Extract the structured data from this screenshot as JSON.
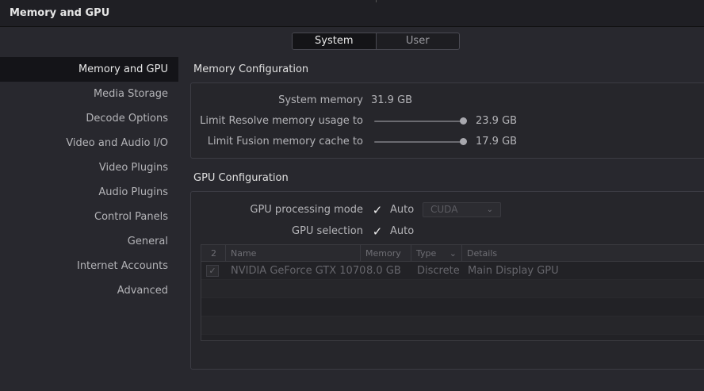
{
  "window": {
    "title": "Memory and GPU"
  },
  "tabs": {
    "system": "System",
    "user": "User"
  },
  "sidebar": {
    "items": [
      {
        "label": "Memory and GPU"
      },
      {
        "label": "Media Storage"
      },
      {
        "label": "Decode Options"
      },
      {
        "label": "Video and Audio I/O"
      },
      {
        "label": "Video Plugins"
      },
      {
        "label": "Audio Plugins"
      },
      {
        "label": "Control Panels"
      },
      {
        "label": "General"
      },
      {
        "label": "Internet Accounts"
      },
      {
        "label": "Advanced"
      }
    ]
  },
  "memory": {
    "title": "Memory Configuration",
    "system_memory_label": "System memory",
    "system_memory_value": "31.9 GB",
    "resolve_limit_label": "Limit Resolve memory usage to",
    "resolve_limit_value": "23.9 GB",
    "resolve_limit_fraction": 1.0,
    "fusion_cache_label": "Limit Fusion memory cache to",
    "fusion_cache_value": "17.9 GB",
    "fusion_cache_fraction": 1.0
  },
  "gpu": {
    "title": "GPU Configuration",
    "processing_mode_label": "GPU processing mode",
    "processing_mode_auto": "Auto",
    "processing_mode_select": "CUDA",
    "selection_label": "GPU selection",
    "selection_auto": "Auto",
    "table": {
      "headers": {
        "count": "2",
        "name": "Name",
        "memory": "Memory",
        "type": "Type",
        "details": "Details"
      },
      "rows": [
        {
          "name": "NVIDIA GeForce GTX 1070",
          "memory": "8.0 GB",
          "type": "Discrete",
          "details": "Main Display GPU"
        }
      ]
    }
  }
}
